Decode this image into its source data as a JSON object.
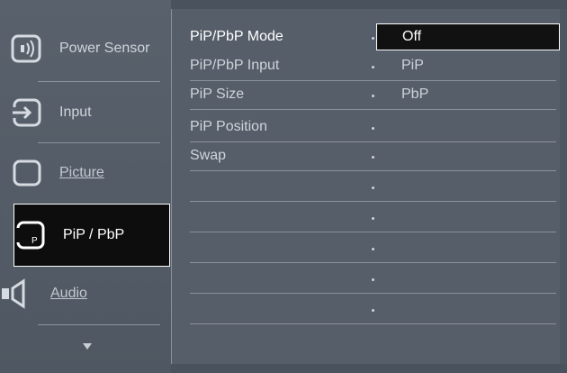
{
  "sidebar": {
    "items": [
      {
        "label": "Power Sensor",
        "icon": "power-sensor-icon"
      },
      {
        "label": "Input",
        "icon": "input-icon"
      },
      {
        "label": "Picture",
        "icon": "picture-icon"
      },
      {
        "label": "PiP / PbP",
        "icon": "pip-icon",
        "icon_text": "P"
      },
      {
        "label": "Audio",
        "icon": "speaker-icon"
      }
    ],
    "scroll_icon": "chevron-down-icon"
  },
  "options": [
    {
      "label": "PiP/PbP Mode"
    },
    {
      "label": "PiP/PbP Input"
    },
    {
      "label": "PiP Size"
    },
    {
      "label": "PiP Position"
    },
    {
      "label": "Swap"
    },
    {
      "label": ""
    },
    {
      "label": ""
    },
    {
      "label": ""
    },
    {
      "label": ""
    },
    {
      "label": ""
    }
  ],
  "values": {
    "selected": "Off",
    "choice_1": "PiP",
    "choice_2": "PbP"
  },
  "colors": {
    "background": "#4e5661",
    "highlight": "#0d0d0d",
    "text": "#cfd4da"
  }
}
